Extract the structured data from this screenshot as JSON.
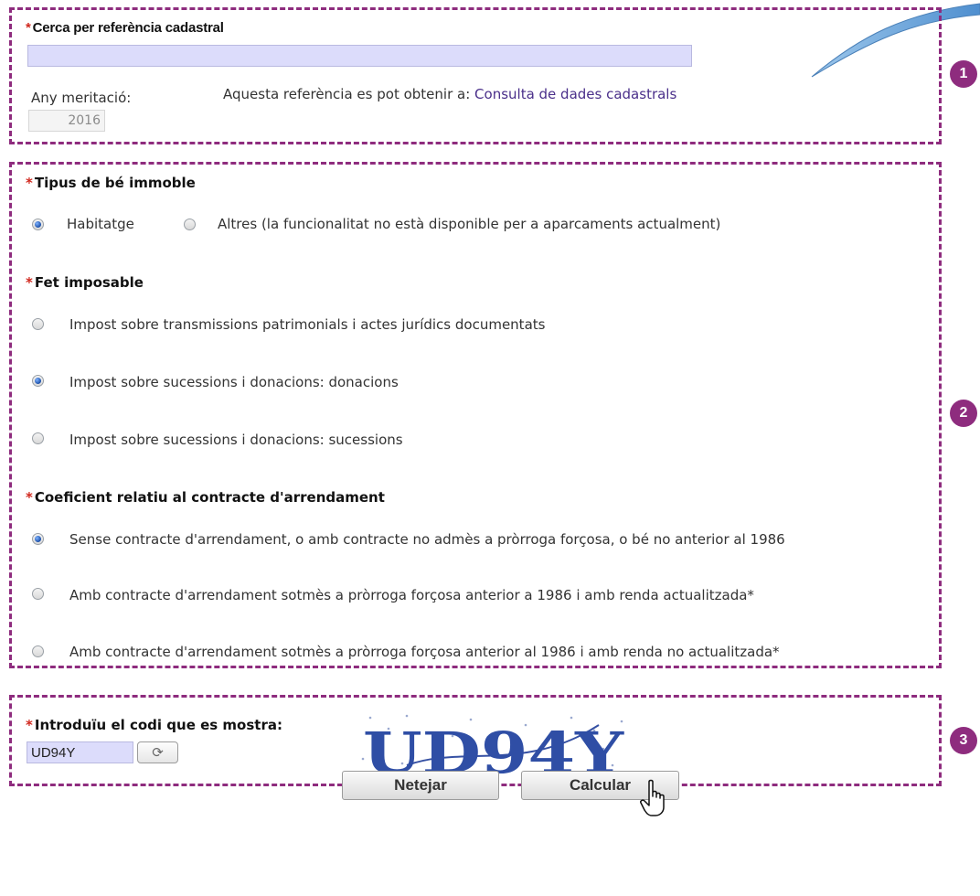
{
  "section1": {
    "badge": "1",
    "cadastral_label": "Cerca per referència cadastral",
    "cadastral_value": "",
    "any_label": "Any meritació:",
    "any_value": "2016",
    "help_text": "Aquesta referència es pot obtenir a:",
    "help_link": "Consulta de dades cadastrals"
  },
  "section2": {
    "badge": "2",
    "tipus_label": "Tipus de bé immoble",
    "tipus_options": [
      {
        "label": "Habitatge",
        "checked": true
      },
      {
        "label": "Altres (la funcionalitat no està disponible per a aparcaments actualment)",
        "checked": false
      }
    ],
    "fet_label": "Fet imposable",
    "fet_options": [
      {
        "label": "Impost sobre transmissions patrimonials i actes jurídics documentats",
        "checked": false
      },
      {
        "label": "Impost sobre sucessions i donacions: donacions",
        "checked": true
      },
      {
        "label": "Impost sobre sucessions i donacions: sucessions",
        "checked": false
      }
    ],
    "coef_label": "Coeficient relatiu al contracte d'arrendament",
    "coef_options": [
      {
        "label": "Sense contracte d'arrendament, o amb contracte no admès a pròrroga forçosa, o bé no anterior al 1986",
        "checked": true
      },
      {
        "label": "Amb contracte d'arrendament sotmès a pròrroga forçosa anterior a 1986 i amb renda actualitzada*",
        "checked": false
      },
      {
        "label": "Amb contracte d'arrendament sotmès a pròrroga forçosa anterior al 1986 i amb renda no actualitzada*",
        "checked": false
      }
    ]
  },
  "section3": {
    "badge": "3",
    "captcha_label": "Introduïu el codi que es mostra:",
    "captcha_value": "UD94Y",
    "captcha_image_text": "UD94Y"
  },
  "buttons": {
    "clear": "Netejar",
    "calculate": "Calcular"
  },
  "icons": {
    "refresh": "refresh-icon",
    "cursor": "hand-pointer-icon"
  },
  "colors": {
    "accent": "#8e2c7e",
    "required": "#d0271d",
    "link": "#4a2f8a",
    "input_bg": "#dcdcfb"
  }
}
